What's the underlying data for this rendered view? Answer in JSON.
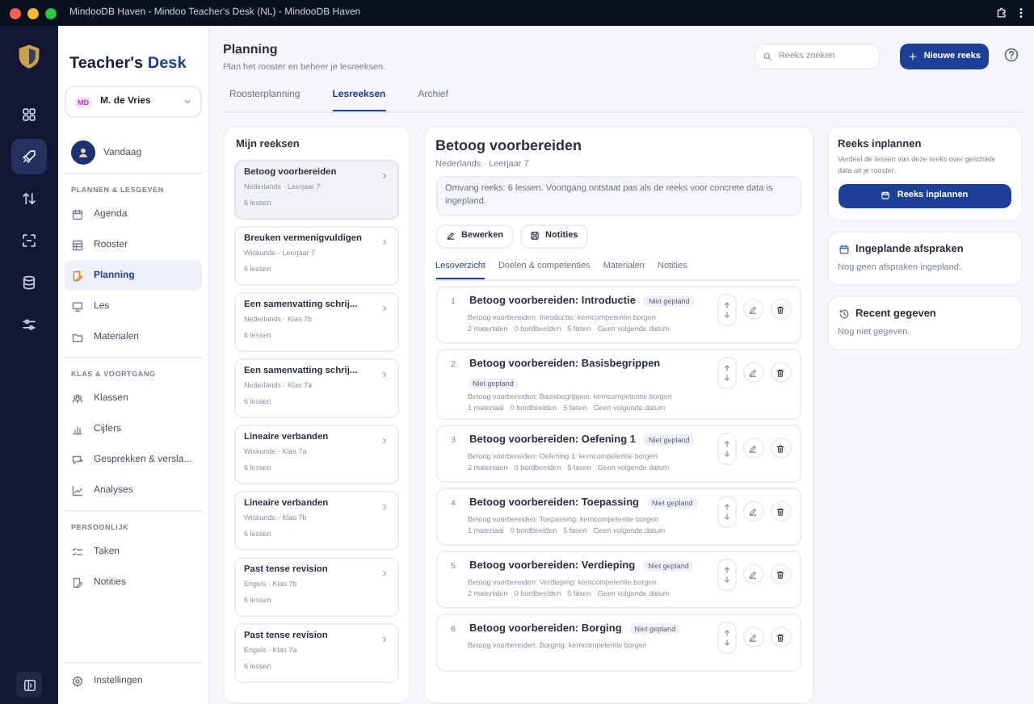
{
  "window": {
    "title": "MindooDB Haven - Mindoo Teacher's Desk (NL) - MindooDB Haven"
  },
  "rail": [
    {
      "selected": false
    },
    {
      "selected": true
    },
    {
      "selected": false
    },
    {
      "selected": false
    },
    {
      "selected": false
    },
    {
      "selected": false
    }
  ],
  "sidebar": {
    "logo": {
      "text": "Teacher's",
      "accent": "Desk"
    },
    "user": {
      "initials": "MD",
      "name": "M. de Vries"
    },
    "today": "Vandaag",
    "sections": [
      {
        "heading": "PLANNEN & LESGEVEN",
        "items": [
          {
            "label": "Agenda",
            "selected": false
          },
          {
            "label": "Rooster",
            "selected": false
          },
          {
            "label": "Planning",
            "selected": true
          },
          {
            "label": "Les",
            "selected": false
          },
          {
            "label": "Materialen",
            "selected": false
          }
        ]
      },
      {
        "heading": "KLAS & VOORTGANG",
        "items": [
          {
            "label": "Klassen",
            "selected": false
          },
          {
            "label": "Cijfers",
            "selected": false
          },
          {
            "label": "Gesprekken & versla...",
            "selected": false
          },
          {
            "label": "Analyses",
            "selected": false
          }
        ]
      },
      {
        "heading": "PERSOONLIJK",
        "items": [
          {
            "label": "Taken",
            "selected": false
          },
          {
            "label": "Notities",
            "selected": false
          }
        ]
      }
    ],
    "settings": "Instellingen"
  },
  "header": {
    "title": "Planning",
    "subtitle": "Plan het rooster en beheer je lesreeksen.",
    "search": {
      "placeholder": "Reeks zoeken"
    },
    "new_button": "Nieuwe reeks"
  },
  "tabs": [
    {
      "label": "Roosterplanning",
      "selected": false
    },
    {
      "label": "Lesreeksen",
      "selected": true
    },
    {
      "label": "Archief",
      "selected": false
    }
  ],
  "series_list": {
    "title": "Mijn reeksen",
    "items": [
      {
        "title": "Betoog voorbereiden",
        "subtitle": "Nederlands · Leerjaar 7",
        "count": "6 lessen",
        "selected": true
      },
      {
        "title": "Breuken vermenigvuldigen",
        "subtitle": "Wiskunde · Leerjaar 7",
        "count": "6 lessen",
        "selected": false
      },
      {
        "title": "Een samenvatting schrij...",
        "subtitle": "Nederlands · Klas 7b",
        "count": "6 lessen",
        "selected": false
      },
      {
        "title": "Een samenvatting schrij...",
        "subtitle": "Nederlands · Klas 7a",
        "count": "6 lessen",
        "selected": false
      },
      {
        "title": "Lineaire verbanden",
        "subtitle": "Wiskunde · Klas 7a",
        "count": "6 lessen",
        "selected": false
      },
      {
        "title": "Lineaire verbanden",
        "subtitle": "Wiskunde · Klas 7b",
        "count": "6 lessen",
        "selected": false
      },
      {
        "title": "Past tense revision",
        "subtitle": "Engels · Klas 7b",
        "count": "6 lessen",
        "selected": false
      },
      {
        "title": "Past tense revision",
        "subtitle": "Engels · Klas 7a",
        "count": "6 lessen",
        "selected": false
      }
    ]
  },
  "detail": {
    "title": "Betoog voorbereiden",
    "subtitle": "Nederlands · Leerjaar 7",
    "info": "Omvang reeks: 6 lessen. Voortgang ontstaat pas als de reeks voor concrete data is ingepland.",
    "actions": [
      "Bewerken",
      "Notities"
    ],
    "tabs": [
      {
        "label": "Lesoverzicht",
        "selected": true
      },
      {
        "label": "Doelen & competenties",
        "selected": false
      },
      {
        "label": "Materialen",
        "selected": false
      },
      {
        "label": "Notities",
        "selected": false
      }
    ],
    "lessons": [
      {
        "number": "1",
        "title": "Betoog voorbereiden: Introductie",
        "status": "Niet gepland",
        "description": "Betoog voorbereiden: Introductie: kerncompetentie borgen",
        "meta": [
          "2 materialen",
          "0 bordbeelden",
          "5 fasen",
          "Geen volgende datum"
        ]
      },
      {
        "number": "2",
        "title": "Betoog voorbereiden: Basisbegrippen",
        "status": "Niet gepland",
        "description": "Betoog voorbereiden: Basisbegrippen: kerncompetentie borgen",
        "meta": [
          "1 materiaal",
          "0 bordbeelden",
          "5 fasen",
          "Geen volgende datum"
        ]
      },
      {
        "number": "3",
        "title": "Betoog voorbereiden: Oefening 1",
        "status": "Niet gepland",
        "description": "Betoog voorbereiden: Oefening 1: kerncompetentie borgen",
        "meta": [
          "2 materialen",
          "0 bordbeelden",
          "5 fasen",
          "Geen volgende datum"
        ]
      },
      {
        "number": "4",
        "title": "Betoog voorbereiden: Toepassing",
        "status": "Niet gepland",
        "description": "Betoog voorbereiden: Toepassing: kerncompetentie borgen",
        "meta": [
          "1 materiaal",
          "0 bordbeelden",
          "5 fasen",
          "Geen volgende datum"
        ]
      },
      {
        "number": "5",
        "title": "Betoog voorbereiden: Verdieping",
        "status": "Niet gepland",
        "description": "Betoog voorbereiden: Verdieping: kerncompetentie borgen",
        "meta": [
          "2 materialen",
          "0 bordbeelden",
          "5 fasen",
          "Geen volgende datum"
        ]
      },
      {
        "number": "6",
        "title": "Betoog voorbereiden: Borging",
        "status": "Niet gepland",
        "description": "Betoog voorbereiden: Borging: kerncompetentie borgen"
      }
    ]
  },
  "side_cards": {
    "schedule": {
      "title": "Reeks inplannen",
      "text": "Verdeel de lessen van deze reeks over geschikte data uit je rooster.",
      "button": "Reeks inplannen"
    },
    "appointments": {
      "title": "Ingeplande afspraken",
      "text": "Nog geen afspraken ingepland."
    },
    "recent": {
      "title": "Recent gegeven",
      "text": "Nog niet gegeven."
    }
  }
}
